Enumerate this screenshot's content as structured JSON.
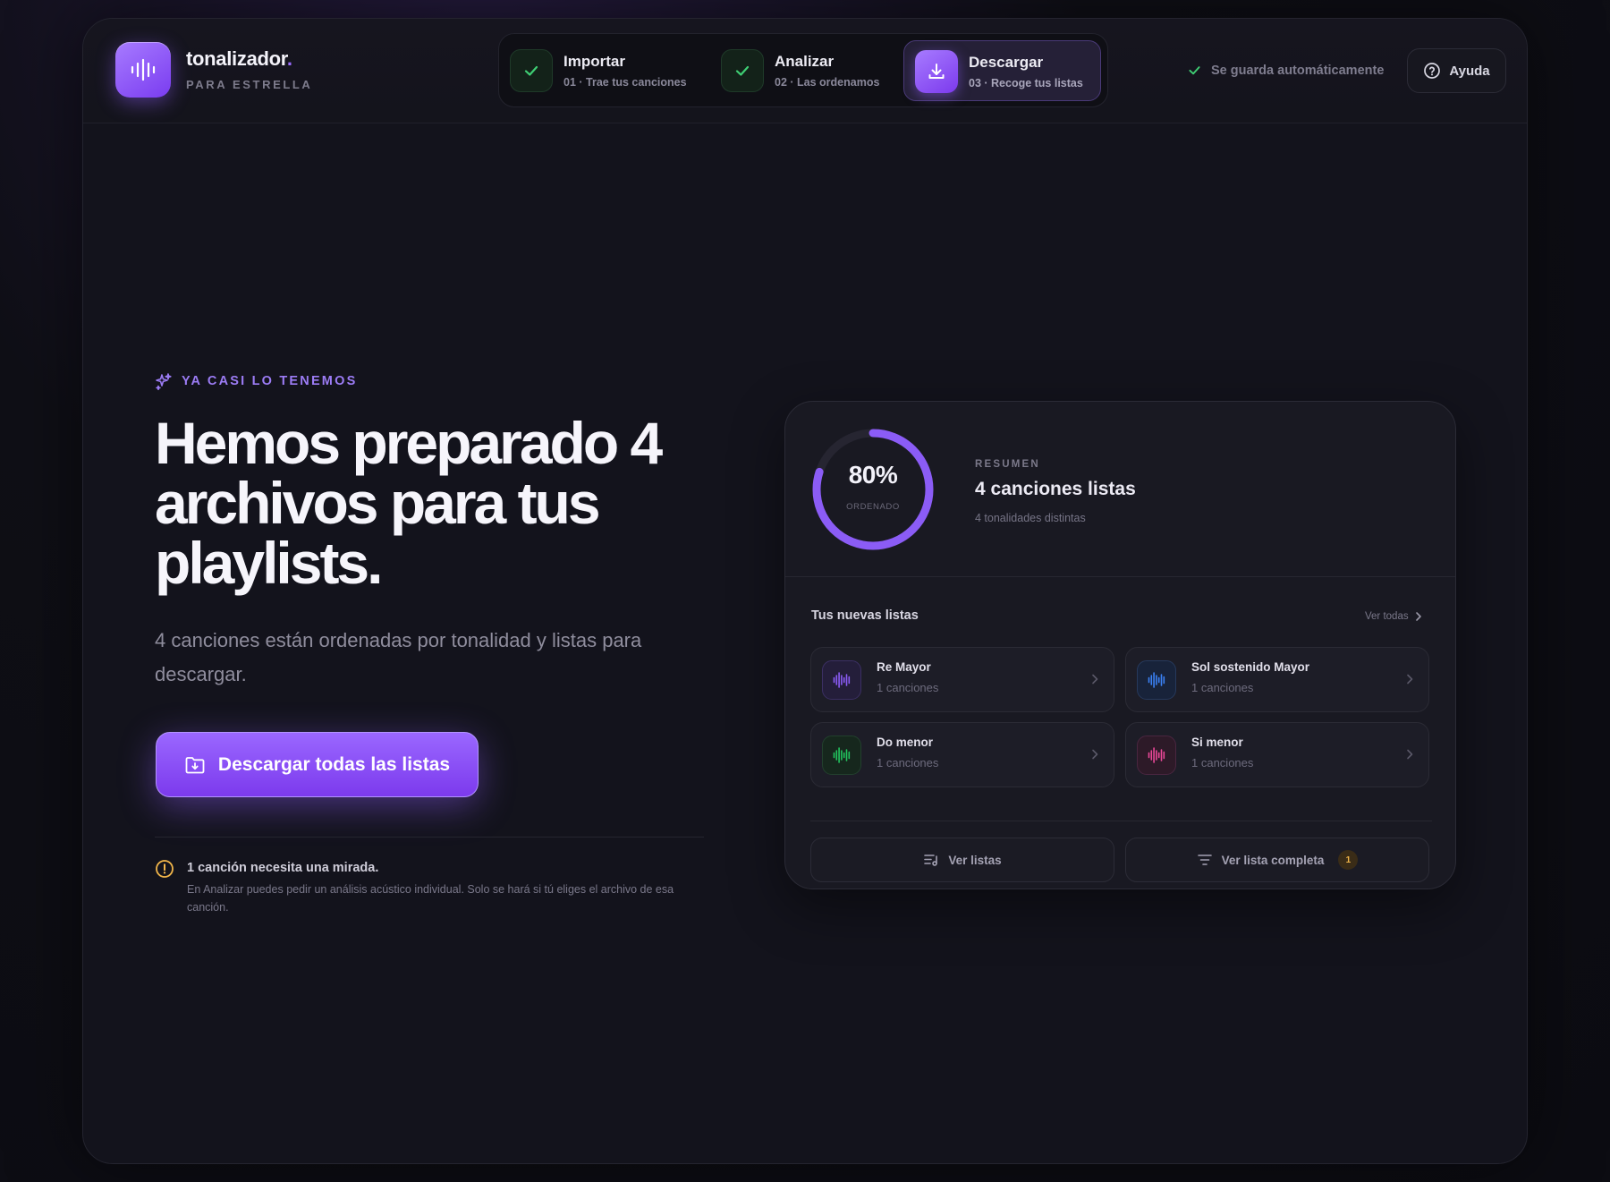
{
  "brand": {
    "name": "tonalizador",
    "dot": ".",
    "subtitle": "PARA ESTRELLA"
  },
  "stepper": [
    {
      "title": "Importar",
      "subtitle": "01 · Trae tus canciones",
      "state": "done",
      "icon": "check-icon"
    },
    {
      "title": "Analizar",
      "subtitle": "02 · Las ordenamos",
      "state": "done",
      "icon": "check-icon"
    },
    {
      "title": "Descargar",
      "subtitle": "03 · Recoge tus listas",
      "state": "active",
      "icon": "download-icon"
    }
  ],
  "header": {
    "autosave": "Se guarda automáticamente",
    "help": "Ayuda"
  },
  "hero": {
    "eyebrow": "YA CASI LO TENEMOS",
    "headline": "Hemos preparado 4 archivos para tus playlists.",
    "lead": "4 canciones están ordenadas por tonalidad y listas para descargar.",
    "cta": "Descargar todas las listas",
    "notice_title": "1 canción necesita una mirada.",
    "notice_body": "En Analizar puedes pedir un análisis acústico individual. Solo se hará si tú eliges el archivo de esa canción."
  },
  "summary": {
    "percent_text": "80%",
    "percent_value": 0.8,
    "percent_label": "ORDENADO",
    "label": "RESUMEN",
    "title": "4 canciones listas",
    "subtitle": "4 tonalidades distintas"
  },
  "lists": {
    "title": "Tus nuevas listas",
    "see_all": "Ver todas",
    "items": [
      {
        "name": "Re Mayor",
        "count": "1 canciones",
        "color": "#8b5cf6",
        "bg": "#241e3a",
        "border": "#3b2f63"
      },
      {
        "name": "Sol sostenido Mayor",
        "count": "1 canciones",
        "color": "#3b82f6",
        "bg": "#18233a",
        "border": "#26395c"
      },
      {
        "name": "Do menor",
        "count": "1 canciones",
        "color": "#22c55e",
        "bg": "#16271d",
        "border": "#22402d"
      },
      {
        "name": "Si menor",
        "count": "1 canciones",
        "color": "#ec4899",
        "bg": "#2d1a28",
        "border": "#4a2640"
      }
    ]
  },
  "footer_buttons": {
    "view_lists": "Ver listas",
    "view_full": "Ver lista completa",
    "full_badge": "1"
  },
  "colors": {
    "accent": "#8b5cf6",
    "success": "#22c55e",
    "warning": "#f59e0b"
  }
}
